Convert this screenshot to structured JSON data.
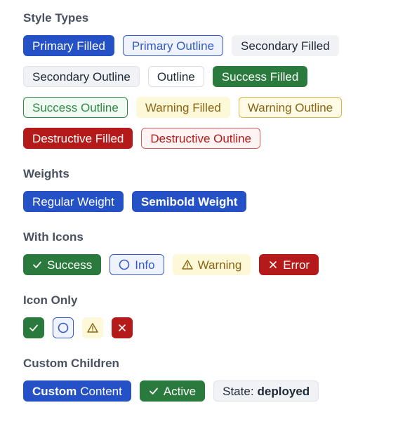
{
  "sections": {
    "style_types": "Style Types",
    "weights": "Weights",
    "with_icons": "With Icons",
    "icon_only": "Icon Only",
    "custom_children": "Custom Children"
  },
  "style_types": {
    "primary_filled": "Primary Filled",
    "primary_outline": "Primary Outline",
    "secondary_filled": "Secondary Filled",
    "secondary_outline": "Secondary Outline",
    "outline": "Outline",
    "success_filled": "Success Filled",
    "success_outline": "Success Outline",
    "warning_filled": "Warning Filled",
    "warning_outline": "Warning Outline",
    "destructive_filled": "Destructive Filled",
    "destructive_outline": "Destructive Outline"
  },
  "weights": {
    "regular": "Regular Weight",
    "semibold": "Semibold Weight"
  },
  "with_icons": {
    "success": "Success",
    "info": "Info",
    "warning": "Warning",
    "error": "Error"
  },
  "custom_children": {
    "custom_bold": "Custom",
    "custom_rest": "Content",
    "active": "Active",
    "state_label": "State:",
    "state_value": "deployed"
  },
  "icons": [
    "check-icon",
    "circle-icon",
    "warning-triangle-icon",
    "x-icon"
  ],
  "colors": {
    "primary": "#2551c7",
    "success": "#2b7a3d",
    "warning": "#8a6410",
    "destructive": "#b41a1a",
    "secondary_bg": "#f0f2f6"
  }
}
